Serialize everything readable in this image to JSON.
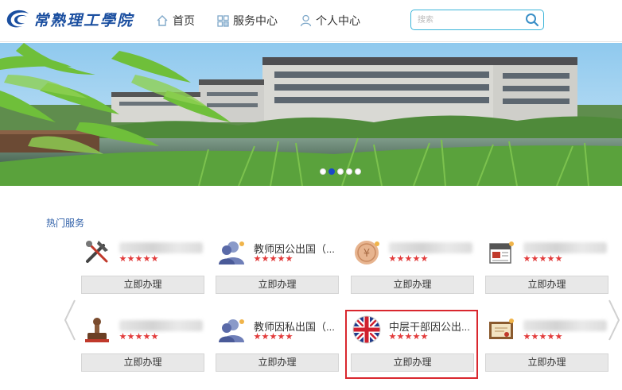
{
  "header": {
    "logo_text": "常熟理工學院",
    "nav": [
      {
        "label": "首页",
        "icon": "home-icon"
      },
      {
        "label": "服务中心",
        "icon": "grid-icon"
      },
      {
        "label": "个人中心",
        "icon": "user-icon"
      }
    ],
    "search": {
      "placeholder": "搜索",
      "value": ""
    }
  },
  "banner": {
    "slide_count": 5,
    "active_slide": 2
  },
  "section": {
    "title": "热门服务"
  },
  "cards": [
    {
      "name": "",
      "icon": "tools-icon",
      "rating": 5,
      "button": "立即办理"
    },
    {
      "name": "教师因公出国（...",
      "icon": "person-icon",
      "rating": 5,
      "button": "立即办理"
    },
    {
      "name": "",
      "icon": "coin-icon",
      "rating": 5,
      "button": "立即办理"
    },
    {
      "name": "",
      "icon": "news-icon",
      "rating": 5,
      "button": "立即办理"
    },
    {
      "name": "",
      "icon": "stamp-icon",
      "rating": 5,
      "button": "立即办理"
    },
    {
      "name": "教师因私出国（...",
      "icon": "person-icon",
      "rating": 5,
      "button": "立即办理"
    },
    {
      "name": "中层干部因公出...",
      "icon": "uk-flag-icon",
      "rating": 5,
      "button": "立即办理"
    },
    {
      "name": "",
      "icon": "certificate-icon",
      "rating": 5,
      "button": "立即办理"
    }
  ],
  "colors": {
    "accent": "#2e5fa8",
    "search_border": "#3cb5d9",
    "star": "#e23b3b",
    "highlight": "#d9272e"
  }
}
